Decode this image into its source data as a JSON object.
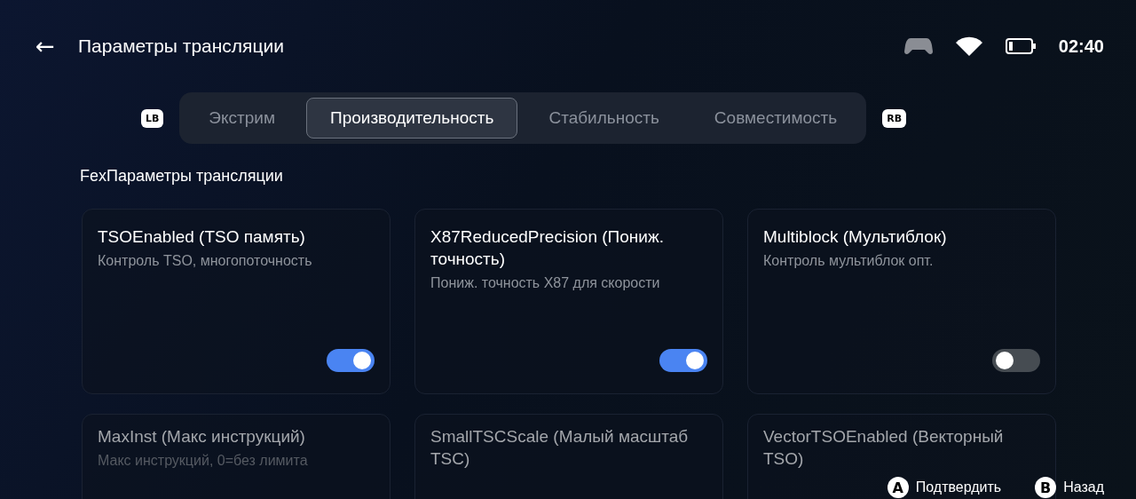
{
  "header": {
    "back": "←",
    "title": "Параметры трансляции",
    "time": "02:40"
  },
  "tabs": {
    "left_key": "LB",
    "right_key": "RB",
    "items": [
      {
        "label": "Экстрим",
        "selected": false
      },
      {
        "label": "Производительность",
        "selected": true
      },
      {
        "label": "Стабильность",
        "selected": false
      },
      {
        "label": "Совместимость",
        "selected": false
      }
    ]
  },
  "section": "FexПараметры трансляции",
  "cards": [
    {
      "title": "TSOEnabled (TSO память)",
      "description": "Контроль TSO, многопоточность",
      "on": true
    },
    {
      "title": "X87ReducedPrecision (Пониж. точность)",
      "description": "Пониж. точность X87 для скорости",
      "on": true
    },
    {
      "title": "Multiblock (Мультиблок)",
      "description": "Контроль мультиблок опт.",
      "on": false
    },
    {
      "title": "MaxInst (Макс инструкций)",
      "description": "Макс инструкций, 0=без лимита"
    },
    {
      "title": "SmallTSCScale (Малый масштаб TSC)"
    },
    {
      "title": "VectorTSOEnabled (Векторный TSO)"
    }
  ],
  "hints": [
    {
      "key": "A",
      "label": "Подтвердить"
    },
    {
      "key": "B",
      "label": "Назад"
    }
  ]
}
